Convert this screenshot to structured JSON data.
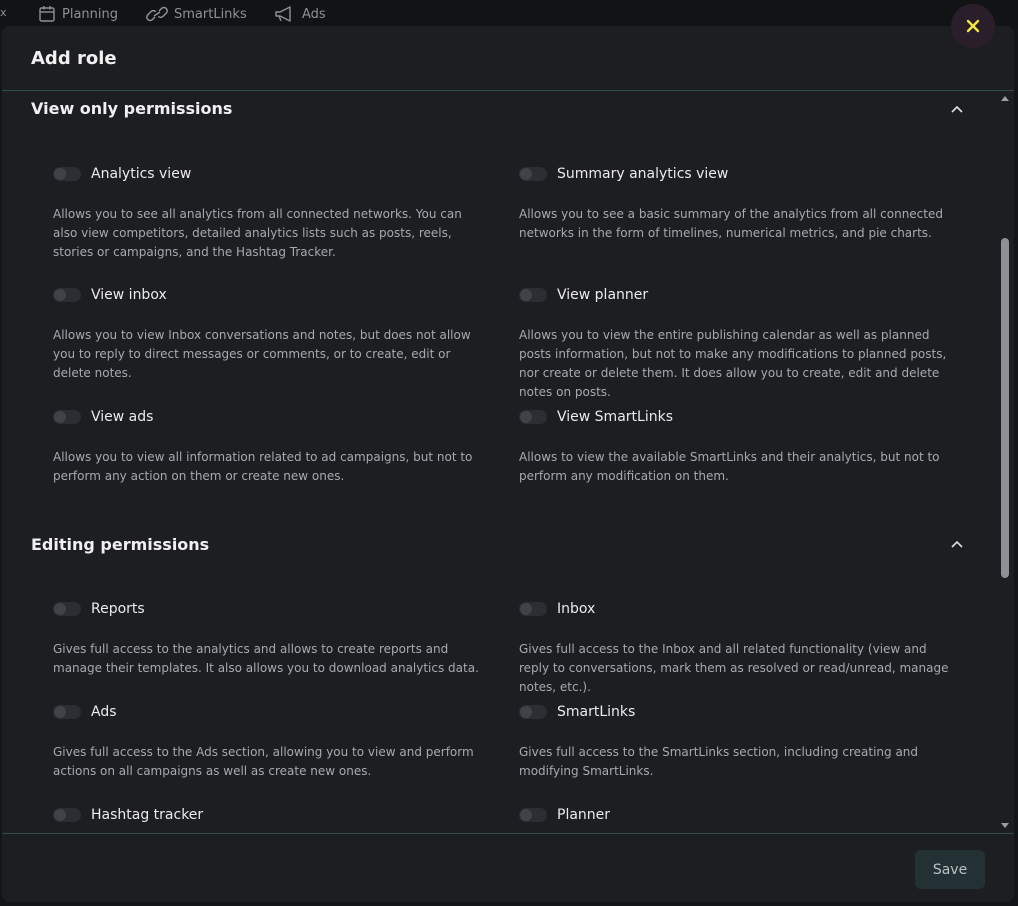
{
  "nav": {
    "x_label": "x",
    "items": [
      {
        "label": "Planning",
        "icon": "calendar-icon"
      },
      {
        "label": "SmartLinks",
        "icon": "link-icon"
      },
      {
        "label": "Ads",
        "icon": "megaphone-icon"
      }
    ]
  },
  "modal": {
    "title": "Add role",
    "save_label": "Save",
    "close_icon": "close-icon",
    "accent_color": "#f2e840"
  },
  "sections": [
    {
      "title": "View only permissions",
      "permissions": [
        {
          "label": "Analytics view",
          "enabled": false,
          "description": "Allows you to see all analytics from all connected networks. You can also view competitors, detailed analytics lists such as posts, reels, stories or campaigns, and the Hashtag Tracker."
        },
        {
          "label": "Summary analytics view",
          "enabled": false,
          "description": "Allows you to see a basic summary of the analytics from all connected networks in the form of timelines, numerical metrics, and pie charts."
        },
        {
          "label": "View inbox",
          "enabled": false,
          "description": "Allows you to view Inbox conversations and notes, but does not allow you to reply to direct messages or comments, or to create, edit or delete notes."
        },
        {
          "label": "View planner",
          "enabled": false,
          "description": "Allows you to view the entire publishing calendar as well as planned posts information, but not to make any modifications to planned posts, nor create or delete them. It does allow you to create, edit and delete notes on posts."
        },
        {
          "label": "View ads",
          "enabled": false,
          "description": "Allows you to view all information related to ad campaigns, but not to perform any action on them or create new ones."
        },
        {
          "label": "View SmartLinks",
          "enabled": false,
          "description": "Allows to view the available SmartLinks and their analytics, but not to perform any modification on them."
        }
      ]
    },
    {
      "title": "Editing permissions",
      "permissions": [
        {
          "label": "Reports",
          "enabled": false,
          "description": "Gives full access to the analytics and allows to create reports and manage their templates. It also allows you to download analytics data."
        },
        {
          "label": "Inbox",
          "enabled": false,
          "description": "Gives full access to the Inbox and all related functionality (view and reply to conversations, mark them as resolved or read/unread, manage notes, etc.)."
        },
        {
          "label": "Ads",
          "enabled": false,
          "description": "Gives full access to the Ads section, allowing you to view and perform actions on all campaigns as well as create new ones."
        },
        {
          "label": "SmartLinks",
          "enabled": false,
          "description": "Gives full access to the SmartLinks section, including creating and modifying SmartLinks."
        },
        {
          "label": "Hashtag tracker",
          "enabled": false,
          "description": ""
        },
        {
          "label": "Planner",
          "enabled": false,
          "description": ""
        }
      ]
    }
  ]
}
